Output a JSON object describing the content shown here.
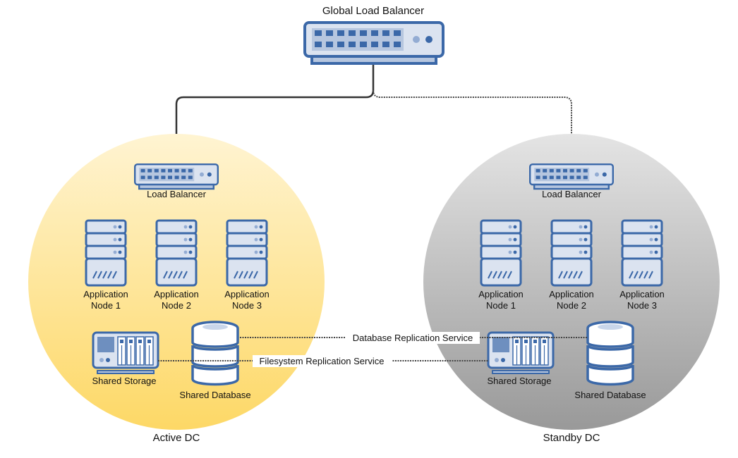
{
  "diagram": {
    "global_lb": {
      "label": "Global Load Balancer",
      "icon": "switch-icon"
    },
    "links": {
      "to_active": {
        "style": "solid"
      },
      "to_standby": {
        "style": "dotted"
      }
    },
    "active": {
      "label": "Active DC",
      "colors": {
        "top": "#fff4d2",
        "bottom": "#fdd866"
      },
      "lb": {
        "label": "Load Balancer"
      },
      "nodes": [
        {
          "line1": "Application",
          "line2": "Node 1"
        },
        {
          "line1": "Application",
          "line2": "Node 2"
        },
        {
          "line1": "Application",
          "line2": "Node 3"
        }
      ],
      "storage": {
        "label": "Shared Storage"
      },
      "database": {
        "label": "Shared Database"
      }
    },
    "standby": {
      "label": "Standby DC",
      "colors": {
        "top": "#e4e4e4",
        "bottom": "#999999"
      },
      "lb": {
        "label": "Load Balancer"
      },
      "nodes": [
        {
          "line1": "Application",
          "line2": "Node 1"
        },
        {
          "line1": "Application",
          "line2": "Node 2"
        },
        {
          "line1": "Application",
          "line2": "Node 3"
        }
      ],
      "storage": {
        "label": "Shared Storage"
      },
      "database": {
        "label": "Shared Database"
      }
    },
    "replication": {
      "db": {
        "label": "Database Replication Service"
      },
      "fs": {
        "label": "Filesystem Replication Service"
      }
    },
    "icon_colors": {
      "stroke": "#3b68a8",
      "fill": "#dbe3f0",
      "accent": "#6e8fbf"
    }
  }
}
